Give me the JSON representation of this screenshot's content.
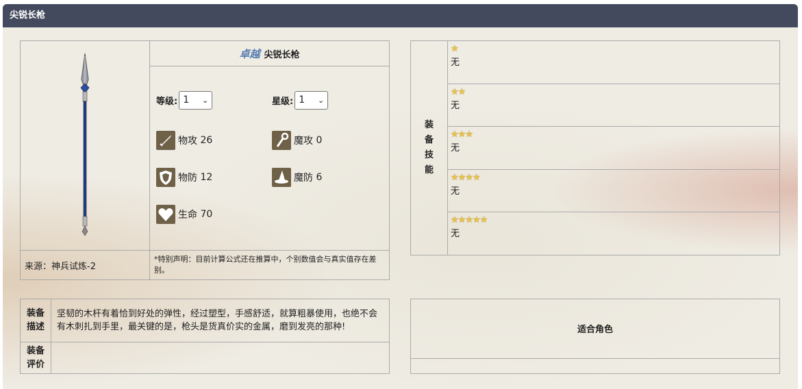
{
  "header": {
    "title": "尖锐长枪"
  },
  "weapon": {
    "quality_label": "卓越",
    "name": "尖锐长枪",
    "level_label": "等级:",
    "level_value": "1",
    "star_label": "星级:",
    "star_value": "1",
    "stats": [
      {
        "label": "物攻",
        "value": "26",
        "icon": "sword-icon"
      },
      {
        "label": "魔攻",
        "value": "0",
        "icon": "staff-icon"
      },
      {
        "label": "物防",
        "value": "12",
        "icon": "shield-icon"
      },
      {
        "label": "魔防",
        "value": "6",
        "icon": "wizard-hat-icon"
      },
      {
        "label": "生命",
        "value": "70",
        "icon": "heart-icon"
      }
    ],
    "source": "来源：神兵试炼-2",
    "note": "*特别声明：目前计算公式还在推算中，个别数值会与真实值存在差别。"
  },
  "skills": {
    "label": "装备技能",
    "rows": [
      {
        "stars": "★",
        "text": "无"
      },
      {
        "stars": "★★",
        "text": "无"
      },
      {
        "stars": "★★★",
        "text": "无"
      },
      {
        "stars": "★★★★",
        "text": "无"
      },
      {
        "stars": "★★★★★",
        "text": "无"
      }
    ]
  },
  "description": {
    "label": "装备描述",
    "text": "坚韧的木杆有着恰到好处的弹性，经过塑型，手感舒适，就算粗暴使用，也绝不会有木刺扎到手里，最关键的是，枪头是货真价实的金属，磨到发亮的那种!",
    "rating_label": "装备评价",
    "rating_text": ""
  },
  "suitable": {
    "label": "适合角色"
  },
  "colors": {
    "header_bg": "#434a5e",
    "icon_bg": "#6f6048",
    "quality": "#5a7fb0",
    "star": "#e8c24a"
  }
}
